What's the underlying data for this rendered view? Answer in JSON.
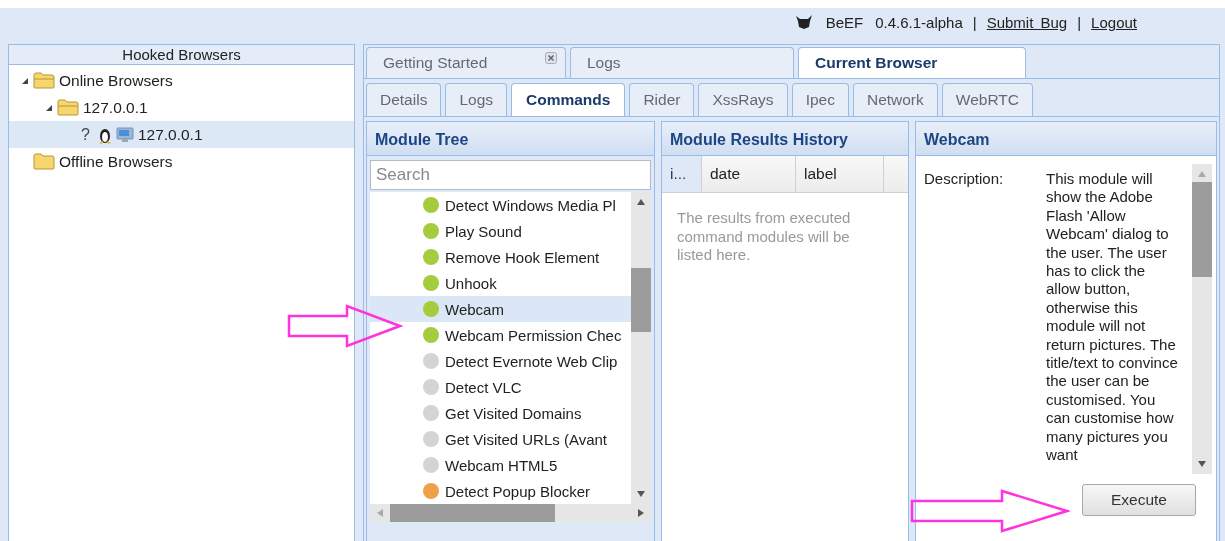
{
  "header": {
    "app_name": "BeEF",
    "version": "0.4.6.1-alpha",
    "separator": "|",
    "links": [
      "Submit  Bug",
      "Logout"
    ]
  },
  "hooked_browsers": {
    "title": "Hooked Browsers",
    "tree": [
      {
        "label": "Online Browsers",
        "kind": "folder",
        "expanded": true,
        "selected": false,
        "children": [
          {
            "label": "127.0.0.1",
            "kind": "folder",
            "expanded": true,
            "selected": false,
            "children": [
              {
                "label": "127.0.0.1",
                "kind": "host",
                "prefix": "?",
                "selected": true
              }
            ]
          }
        ]
      },
      {
        "label": "Offline Browsers",
        "kind": "folder",
        "selected": false
      }
    ]
  },
  "main_tabs": [
    {
      "label": "Getting Started",
      "closable": true,
      "selected": false
    },
    {
      "label": "Logs",
      "closable": false,
      "selected": false
    },
    {
      "label": "Current Browser",
      "closable": false,
      "selected": true
    }
  ],
  "sub_tabs": [
    {
      "label": "Details",
      "selected": false
    },
    {
      "label": "Logs",
      "selected": false
    },
    {
      "label": "Commands",
      "selected": true
    },
    {
      "label": "Rider",
      "selected": false
    },
    {
      "label": "XssRays",
      "selected": false
    },
    {
      "label": "Ipec",
      "selected": false
    },
    {
      "label": "Network",
      "selected": false
    },
    {
      "label": "WebRTC",
      "selected": false
    }
  ],
  "module_tree": {
    "title": "Module Tree",
    "search": {
      "placeholder": "Search"
    },
    "modules": [
      {
        "label": "Detect Windows Media Pl",
        "color": "#a4cc3c",
        "selected": false
      },
      {
        "label": "Play Sound",
        "color": "#a4cc3c",
        "selected": false
      },
      {
        "label": "Remove Hook Element",
        "color": "#a4cc3c",
        "selected": false
      },
      {
        "label": "Unhook",
        "color": "#a4cc3c",
        "selected": false
      },
      {
        "label": "Webcam",
        "color": "#a4cc3c",
        "selected": true
      },
      {
        "label": "Webcam Permission Chec",
        "color": "#a4cc3c",
        "selected": false
      },
      {
        "label": "Detect Evernote Web Clip",
        "color": "#d4d4d4",
        "selected": false
      },
      {
        "label": "Detect VLC",
        "color": "#d4d4d4",
        "selected": false
      },
      {
        "label": "Get Visited Domains",
        "color": "#d4d4d4",
        "selected": false
      },
      {
        "label": "Get Visited URLs (Avant",
        "color": "#d4d4d4",
        "selected": false
      },
      {
        "label": "Webcam HTML5",
        "color": "#d4d4d4",
        "selected": false
      },
      {
        "label": "Detect Popup Blocker",
        "color": "#f0a04b",
        "selected": false
      }
    ]
  },
  "results_history": {
    "title": "Module Results History",
    "columns": [
      "i...",
      "date",
      "label"
    ],
    "empty_text": "The results from executed command modules will be listed here."
  },
  "module_panel": {
    "title": "Webcam",
    "field_label": "Description:",
    "description": "This module will show the Adobe Flash 'Allow Webcam' dialog to the user. The user has to click the allow button, otherwise this module will not return pictures. The title/text to convince the user can be customised. You can customise how many pictures you want",
    "button": "Execute"
  }
}
